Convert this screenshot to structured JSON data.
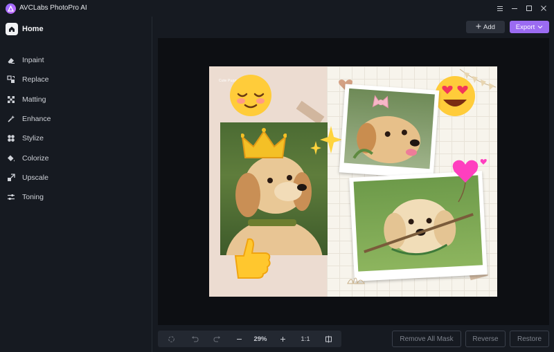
{
  "app": {
    "title": "AVCLabs PhotoPro AI"
  },
  "window_controls": [
    "menu-icon",
    "minimize-icon",
    "maximize-icon",
    "close-icon"
  ],
  "sidebar": {
    "home_label": "Home",
    "items": [
      {
        "label": "Inpaint",
        "icon": "eraser-icon"
      },
      {
        "label": "Replace",
        "icon": "replace-icon"
      },
      {
        "label": "Matting",
        "icon": "matting-icon"
      },
      {
        "label": "Enhance",
        "icon": "enhance-icon"
      },
      {
        "label": "Stylize",
        "icon": "stylize-icon"
      },
      {
        "label": "Colorize",
        "icon": "colorize-icon"
      },
      {
        "label": "Upscale",
        "icon": "upscale-icon"
      },
      {
        "label": "Toning",
        "icon": "toning-icon"
      }
    ]
  },
  "header": {
    "add_label": "Add",
    "export_label": "Export"
  },
  "artwork": {
    "caption": "Cute Puppy"
  },
  "toolbar": {
    "zoom": "29%",
    "actual_size": "1:1",
    "remove_all_mask": "Remove All Mask",
    "reverse": "Reverse",
    "restore": "Restore"
  },
  "colors": {
    "accent": "#9b6bf2",
    "background": "#161a21",
    "canvas": "#0d0f13"
  }
}
